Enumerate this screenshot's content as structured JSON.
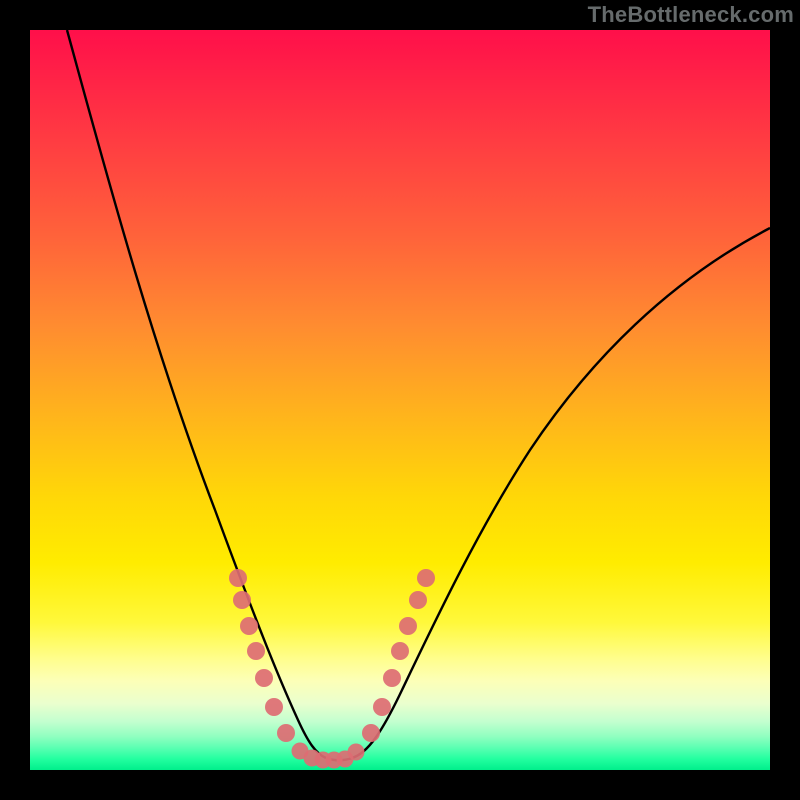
{
  "watermark": {
    "text": "TheBottleneck.com"
  },
  "chart_data": {
    "type": "line",
    "title": "",
    "xlabel": "",
    "ylabel": "",
    "xlim": [
      0,
      100
    ],
    "ylim": [
      0,
      100
    ],
    "series": [
      {
        "name": "bottleneck-curve",
        "x": [
          5,
          8,
          12,
          16,
          20,
          24,
          28,
          30,
          32,
          34,
          36,
          38,
          40,
          42,
          44,
          46,
          50,
          55,
          60,
          65,
          70,
          78,
          88,
          100
        ],
        "y": [
          100,
          87,
          73,
          60,
          48,
          36,
          25,
          20,
          15,
          10,
          6,
          3,
          1.5,
          1.5,
          3,
          6,
          13,
          22,
          31,
          39,
          47,
          56,
          65,
          73
        ]
      }
    ],
    "markers": {
      "name": "marker-dots",
      "color": "#dd6d73",
      "points_xy": [
        [
          28,
          26
        ],
        [
          28.5,
          23
        ],
        [
          29.5,
          19.5
        ],
        [
          30.5,
          16
        ],
        [
          31.5,
          12.5
        ],
        [
          33,
          8.5
        ],
        [
          34.5,
          5
        ],
        [
          36.5,
          2.5
        ],
        [
          38,
          1.6
        ],
        [
          39.5,
          1.4
        ],
        [
          41,
          1.4
        ],
        [
          42.5,
          1.6
        ],
        [
          44,
          2.5
        ],
        [
          46,
          5
        ],
        [
          47.5,
          8.5
        ],
        [
          49,
          12.5
        ],
        [
          50,
          16
        ],
        [
          51,
          19.5
        ],
        [
          52.5,
          23
        ],
        [
          53.5,
          26
        ]
      ]
    },
    "gradient_stops": [
      {
        "pos": 0,
        "color": "#ff0f4a"
      },
      {
        "pos": 0.5,
        "color": "#ffc414"
      },
      {
        "pos": 0.8,
        "color": "#fff83a"
      },
      {
        "pos": 1.0,
        "color": "#00ef8b"
      }
    ]
  }
}
